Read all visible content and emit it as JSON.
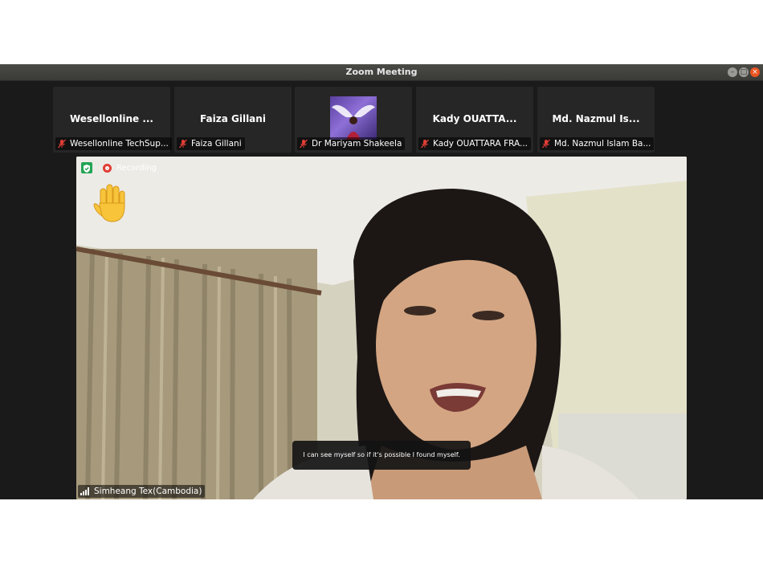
{
  "window": {
    "title": "Zoom Meeting",
    "controls": {
      "minimize": "–",
      "maximize": "□",
      "close": "×"
    }
  },
  "participants_strip": [
    {
      "display_name": "Wesellonline ...",
      "label": "Wesellonline TechSup...",
      "muted": true,
      "has_video": false
    },
    {
      "display_name": "Faiza Gillani",
      "label": "Faiza Gillani",
      "muted": true,
      "has_video": false
    },
    {
      "display_name": "",
      "label": "Dr Mariyam Shakeela",
      "muted": true,
      "has_video": true
    },
    {
      "display_name": "Kady OUATTA...",
      "label": "Kady OUATTARA FRA...",
      "muted": true,
      "has_video": false
    },
    {
      "display_name": "Md. Nazmul Is...",
      "label": "Md. Nazmul Islam Ba...",
      "muted": true,
      "has_video": false
    }
  ],
  "active_speaker": {
    "name": "Simheang Tex(Cambodia)",
    "recording_label": "Recording",
    "caption": "I can see myself so if it's possible I found myself.",
    "reaction": "raised-hand"
  },
  "colors": {
    "titlebar": "#3f3f3c",
    "background": "#1a1a1a",
    "tile": "#262626",
    "mute_red": "#e03e36",
    "secure_green": "#23a455"
  }
}
